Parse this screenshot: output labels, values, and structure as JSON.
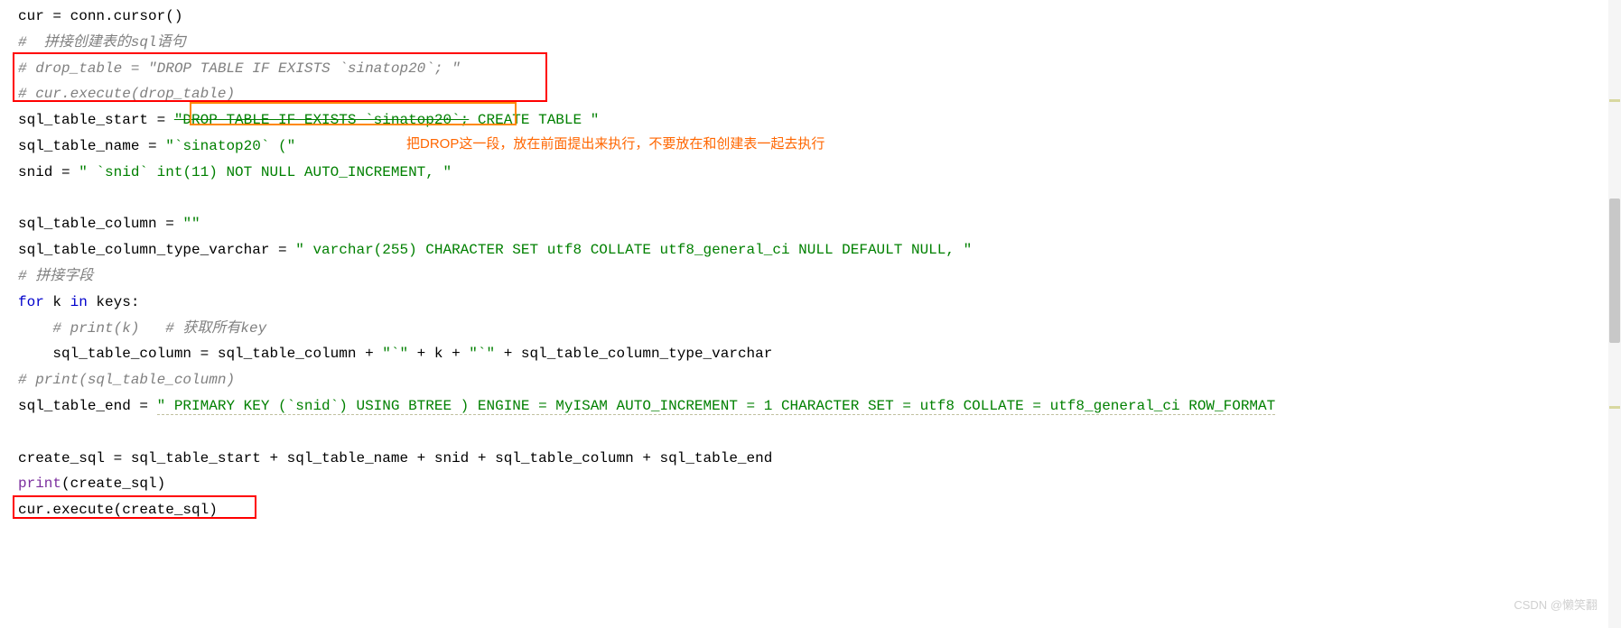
{
  "code": {
    "line1_a": "cur = conn.cursor()",
    "line2_comment": "#  拼接创建表的sql语句",
    "line3_comment": "# drop_table = \"DROP TABLE IF EXISTS `sinatop20`; \"",
    "line4_comment": "# cur.execute(drop_table)",
    "line5_pre": "sql_table_start = ",
    "line5_str1": "\"DROP TABLE IF EXISTS `sinatop20`;",
    "line5_str2": " CREATE TABLE \"",
    "line6_pre": "sql_table_name = ",
    "line6_str": "\"`sinatop20` (\"",
    "line7_pre": "snid = ",
    "line7_str": "\" `snid` int(11) NOT NULL AUTO_INCREMENT, \"",
    "line9_pre": "sql_table_column = ",
    "line9_str": "\"\"",
    "line10_pre": "sql_table_column_type_varchar = ",
    "line10_str": "\" varchar(255) CHARACTER SET utf8 COLLATE utf8_general_ci NULL DEFAULT NULL, \"",
    "line11_comment": "# 拼接字段",
    "line12_for": "for",
    "line12_k": " k ",
    "line12_in": "in",
    "line12_keys": " keys:",
    "line13_comment": "    # print(k)   # 获取所有key",
    "line14_pre": "    sql_table_column = sql_table_column + ",
    "line14_s1": "\"`\"",
    "line14_p1": " + k + ",
    "line14_s2": "\"`\"",
    "line14_p2": " + sql_table_column_type_varchar",
    "line15_comment": "# print(sql_table_column)",
    "line16_pre": "sql_table_end = ",
    "line16_str": "\" PRIMARY KEY (`snid`) USING BTREE ) ENGINE = MyISAM AUTO_INCREMENT = 1 CHARACTER SET = utf8 COLLATE = utf8_general_ci ROW_FORMAT",
    "line18_pre": "create_sql = sql_table_start + sql_table_name + snid + sql_table_column + sql_table_end",
    "line19_print": "print",
    "line19_arg": "(create_sql)",
    "line20": "cur.execute(create_sql)"
  },
  "annotation": "把DROP这一段，放在前面提出来执行，不要放在和创建表一起去执行",
  "watermark": "CSDN @懒笑翻"
}
